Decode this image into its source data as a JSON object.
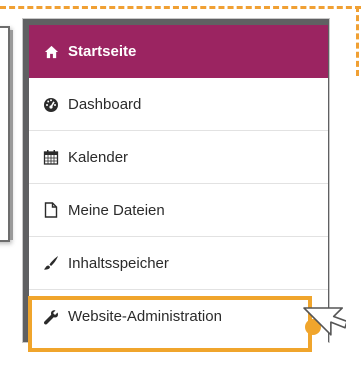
{
  "nav": {
    "items": [
      {
        "label": "Startseite",
        "icon": "home-icon",
        "active": true
      },
      {
        "label": "Dashboard",
        "icon": "tachometer-icon"
      },
      {
        "label": "Kalender",
        "icon": "calendar-icon"
      },
      {
        "label": "Meine Dateien",
        "icon": "file-icon"
      },
      {
        "label": "Inhaltsspeicher",
        "icon": "paintbrush-icon"
      },
      {
        "label": "Website-Administration",
        "icon": "wrench-icon",
        "highlighted": true
      }
    ]
  },
  "colors": {
    "accent": "#9b2461",
    "highlight": "#f0a52c",
    "nav_background": "#5f6062"
  }
}
